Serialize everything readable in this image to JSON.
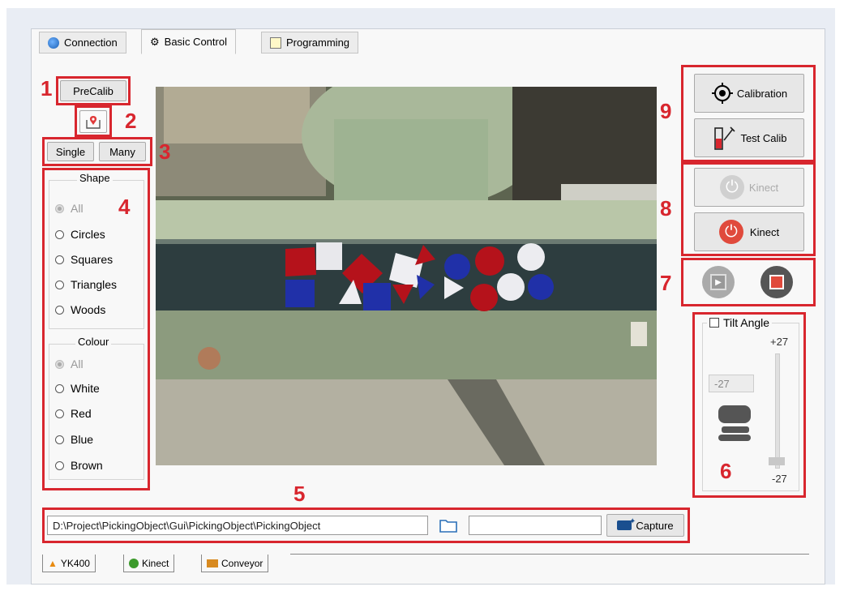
{
  "tabs": [
    {
      "label": "Connection",
      "icon": "globe-icon"
    },
    {
      "label": "Basic Control",
      "icon": "robot-icon"
    },
    {
      "label": "Programming",
      "icon": "edit-icon"
    }
  ],
  "left": {
    "precalib_label": "PreCalib",
    "single_label": "Single",
    "many_label": "Many",
    "shape_title": "Shape",
    "shape_options": [
      "All",
      "Circles",
      "Squares",
      "Triangles",
      "Woods"
    ],
    "colour_title": "Colour",
    "colour_options": [
      "All",
      "White",
      "Red",
      "Blue",
      "Brown"
    ]
  },
  "right": {
    "calibration_label": "Calibration",
    "test_calib_label": "Test Calib",
    "kinect_off_label": "Kinect",
    "kinect_on_label": "Kinect",
    "tilt_label": "Tilt Angle",
    "tilt_max": "+27",
    "tilt_min": "-27",
    "tilt_value": "-27"
  },
  "bottom": {
    "path_value": "D:\\Project\\PickingObject\\Gui\\PickingObject\\PickingObject",
    "name_value": "",
    "capture_label": "Capture",
    "bottom_tabs": [
      "YK400",
      "Kinect",
      "Conveyor"
    ]
  },
  "annotations": [
    "1",
    "2",
    "3",
    "4",
    "5",
    "6",
    "7",
    "8",
    "9"
  ],
  "colors": {
    "annotation": "#d8262e",
    "power_off": "#e04a3c",
    "window_bg": "#f8f8f8"
  }
}
